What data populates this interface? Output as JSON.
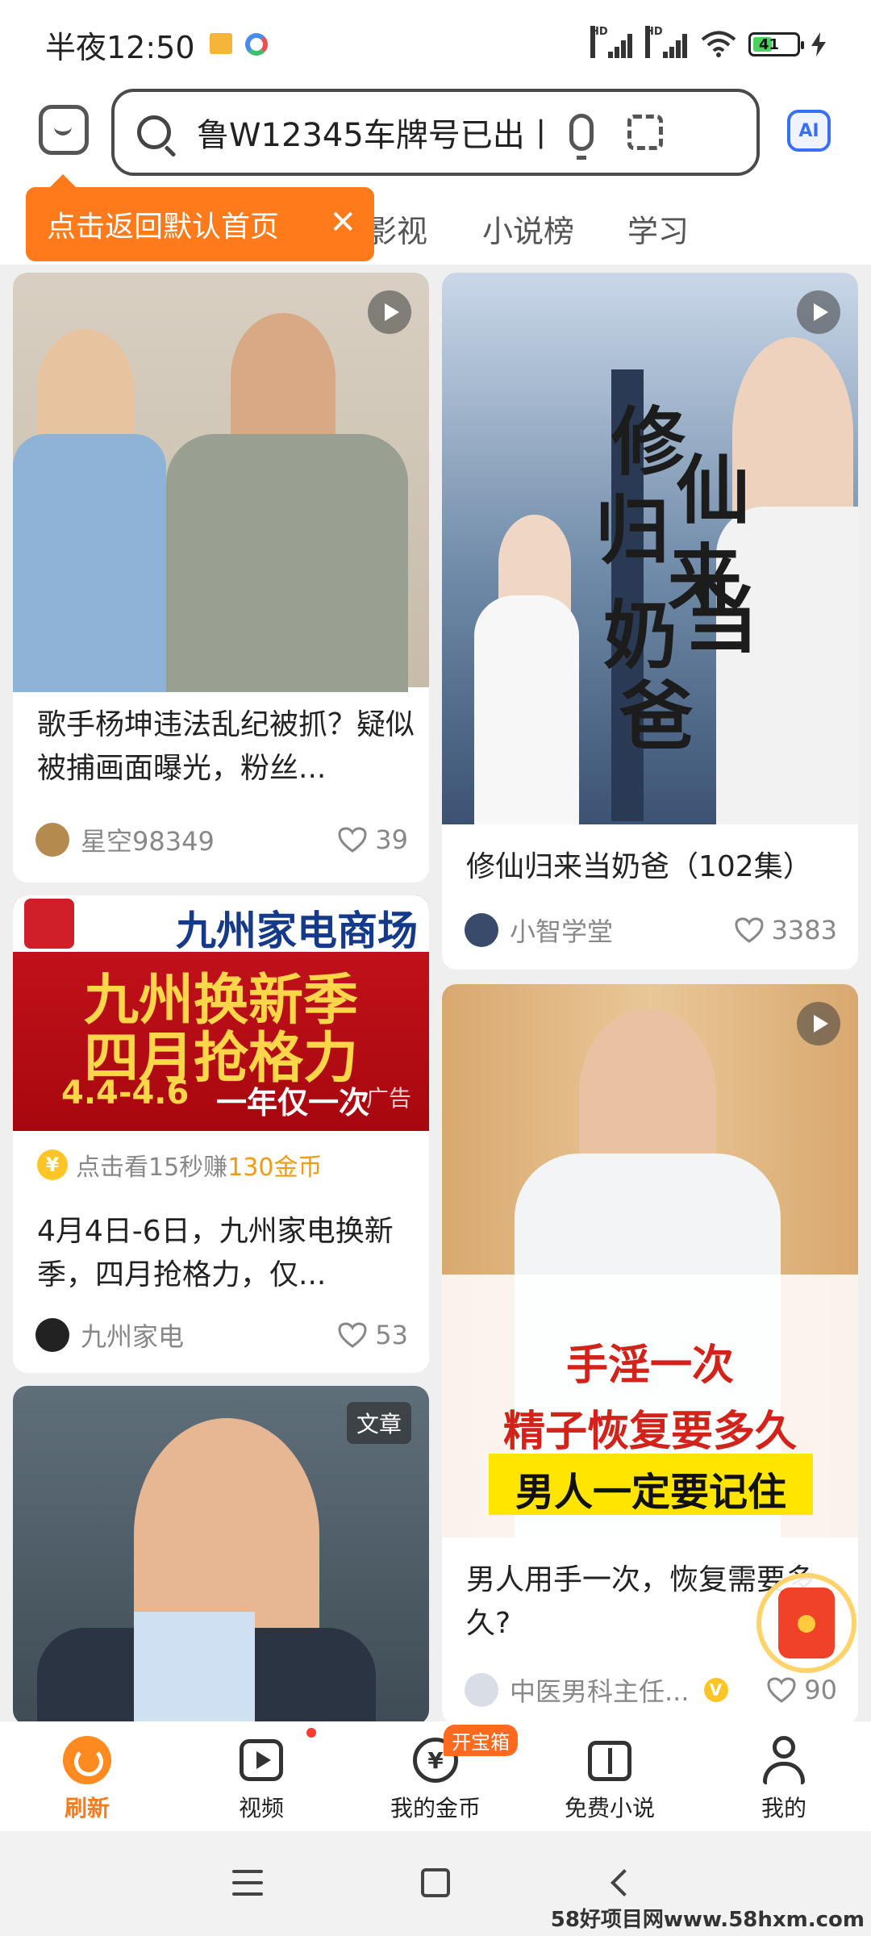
{
  "status": {
    "time": "半夜12:50",
    "battery": "41"
  },
  "search": {
    "query": "鲁W12345车牌号已出丨"
  },
  "header": {
    "ai_label": "AI",
    "tabs": [
      "影视",
      "小说榜",
      "学习"
    ],
    "tooltip": "点击返回默认首页"
  },
  "feed": {
    "card1": {
      "title": "歌手杨坤违法乱纪被抓？疑似被捕画面曝光，粉丝...",
      "author": "星空98349",
      "likes": "39"
    },
    "card2": {
      "image_text": [
        "修",
        "仙",
        "归",
        "来",
        "当",
        "奶",
        "爸"
      ],
      "title": "修仙归来当奶爸（102集）",
      "author": "小智学堂",
      "likes": "3383"
    },
    "card3": {
      "brand": "九州家电商场",
      "headline1": "九州换新季",
      "headline2": "四月抢格力",
      "date": "4.4-4.6",
      "slogan": "一年仅一次",
      "ad_tag": "广告",
      "coin_prefix": "点击看15秒赚",
      "coin_amount": "130金币",
      "title": "4月4日-6日，九州家电换新季，四月抢格力，仅...",
      "author": "九州家电",
      "likes": "53"
    },
    "card4": {
      "overlay1": "手淫一次",
      "overlay2": "精子恢复要多久",
      "overlay3": "男人一定要记住",
      "title": "男人用手一次，恢复需要多久?",
      "author": "中医男科主任...",
      "likes": "90"
    },
    "card5": {
      "badge": "文章"
    }
  },
  "bottom_nav": {
    "refresh": "刷新",
    "video": "视频",
    "coins": "我的金币",
    "treasure_badge": "开宝箱",
    "novels": "免费小说",
    "me": "我的"
  },
  "watermark": "58好项目网www.58hxm.com",
  "colors": {
    "accent": "#ff7a1a",
    "ai": "#3a6ff5",
    "coin": "#ffc526"
  }
}
